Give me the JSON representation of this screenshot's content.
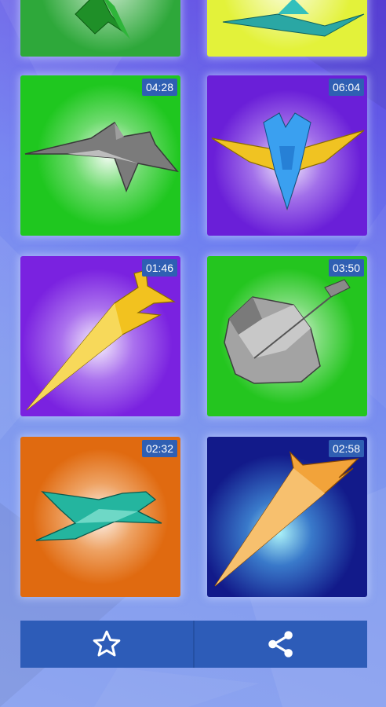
{
  "tiles": [
    {
      "id": "top-left",
      "duration": "",
      "bg": "#2ea83a",
      "glow": "#e8ffe8"
    },
    {
      "id": "top-right",
      "duration": "",
      "bg": "#e3f23a",
      "glow": "#fbffe0"
    },
    {
      "id": "f22-plane",
      "duration": "04:28",
      "bg": "#1fc71f",
      "glow": "#ffffff",
      "icon": "gray-jet-plane-icon"
    },
    {
      "id": "delta-glider",
      "duration": "06:04",
      "bg": "#6a1fd8",
      "glow": "#ffffff",
      "icon": "blue-yellow-glider-icon"
    },
    {
      "id": "yellow-dart",
      "duration": "01:46",
      "bg": "#7a22e0",
      "glow": "#ffffff",
      "icon": "yellow-dart-plane-icon"
    },
    {
      "id": "gray-pod",
      "duration": "03:50",
      "bg": "#24c51f",
      "glow": "#ffffff",
      "icon": "gray-pod-plane-icon"
    },
    {
      "id": "teal-jet",
      "duration": "02:32",
      "bg": "#e06a10",
      "glow": "#ffffff",
      "icon": "teal-jet-plane-icon"
    },
    {
      "id": "orange-arrow",
      "duration": "02:58",
      "bg": "#121a8a",
      "glow": "#9ff0ff",
      "icon": "orange-arrow-plane-icon"
    }
  ],
  "bottom_bar": {
    "favorite_icon": "star-outline-icon",
    "share_icon": "share-icon"
  },
  "colors": {
    "badge": "#2f5fb3",
    "bar": "#2d5cb8"
  }
}
